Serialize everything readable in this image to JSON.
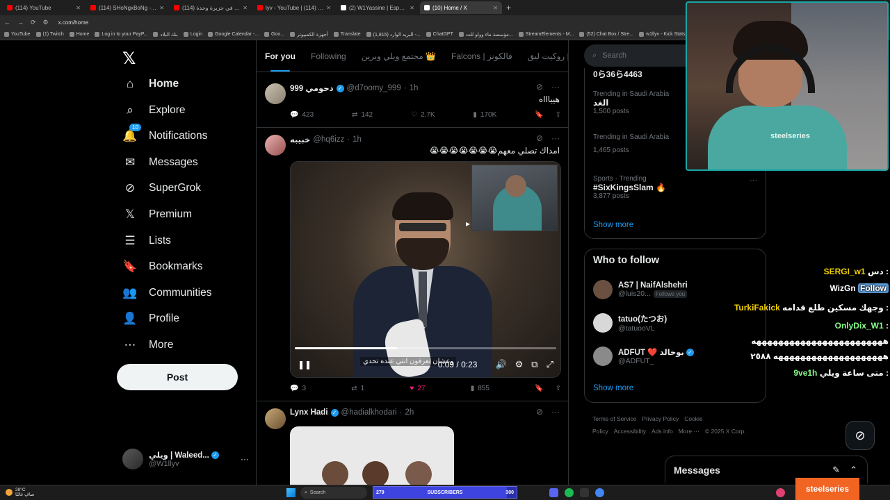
{
  "browser": {
    "tabs": [
      {
        "label": "(114) YouTube",
        "color": "#ff0000"
      },
      {
        "label": "(114) SHoNgxBoNg - YouTube",
        "color": "#ff0000"
      },
      {
        "label": "(114) كل الأغنية في جزيرة وحدة",
        "color": "#ff0000"
      },
      {
        "label": "lyv - YouTube | أبو شمالي (114)",
        "color": "#ff0000"
      },
      {
        "label": "(2) W1Yassine | Esports on X",
        "color": "#ffffff"
      },
      {
        "label": "(10) Home / X",
        "color": "#ffffff",
        "active": true
      }
    ],
    "url": "x.com/home",
    "bookmarks": [
      "YouTube",
      "(1) Twitch",
      "Home",
      "Log in to your PayP...",
      "بنك البلاد",
      "Login",
      "Google Calendar -...",
      "Goo...",
      "أجهزة الكمبيوتر",
      "Translate",
      "(1,815) البريد الوارد -...",
      "ChatGPT",
      "مؤسسة ماء وولو للت...",
      "StreamElements - M...",
      "(52) Chat Box / Stre...",
      "w1llyv - Kick Stats,...",
      "Kick",
      "botr"
    ]
  },
  "nav": {
    "items": [
      {
        "label": "Home",
        "icon": "home-icon",
        "glyph": "⌂",
        "bold": true
      },
      {
        "label": "Explore",
        "icon": "search-icon",
        "glyph": "⌕"
      },
      {
        "label": "Notifications",
        "icon": "bell-icon",
        "glyph": "🔔",
        "badge": "10"
      },
      {
        "label": "Messages",
        "icon": "mail-icon",
        "glyph": "✉"
      },
      {
        "label": "SuperGrok",
        "icon": "grok-icon",
        "glyph": "⊘"
      },
      {
        "label": "Premium",
        "icon": "x-premium-icon",
        "glyph": "𝕏"
      },
      {
        "label": "Lists",
        "icon": "list-icon",
        "glyph": "☰"
      },
      {
        "label": "Bookmarks",
        "icon": "bookmark-icon",
        "glyph": "🔖"
      },
      {
        "label": "Communities",
        "icon": "people-icon",
        "glyph": "👥"
      },
      {
        "label": "Profile",
        "icon": "person-icon",
        "glyph": "👤"
      },
      {
        "label": "More",
        "icon": "more-circle-icon",
        "glyph": "⋯"
      }
    ],
    "post_label": "Post",
    "account": {
      "name": "ويلي | Waleed...",
      "handle": "@W1llyv"
    }
  },
  "timeline": {
    "tabs": [
      {
        "label": "For you",
        "active": true
      },
      {
        "label": "Following"
      },
      {
        "label": "مجتمع ويلي وبرين 👑"
      },
      {
        "label": "Falcons | فالكونز"
      },
      {
        "label": "روكيت ليق | RL"
      }
    ],
    "tweets": [
      {
        "name": "999 دحومي",
        "handle": "@d7oomy_999",
        "time": "1h",
        "text": "هيياااه",
        "replies": "423",
        "reposts": "142",
        "likes": "2.7K",
        "views": "170K"
      },
      {
        "name": "خبيبه",
        "handle": "@hq6izz",
        "time": "1h",
        "text": "امداك تصلي معهم😭😭😭😭😭😭😭",
        "video": {
          "current": "0:09",
          "duration": "0:23",
          "progress": 0.39,
          "subtitle": "وعشان تعرفون انتي عنده تحدي"
        },
        "replies": "3",
        "reposts": "1",
        "likes": "27",
        "views": "855",
        "liked": true
      },
      {
        "name": "Lynx Hadi",
        "handle": "@hadialkhodari",
        "time": "2h"
      }
    ]
  },
  "right": {
    "search_placeholder": "Search",
    "trends": [
      {
        "context": "",
        "title": "0ら36ら4463",
        "count": ""
      },
      {
        "context": "Trending in Saudi Arabia",
        "title": "الغد",
        "count": "1,500 posts"
      },
      {
        "context": "Trending in Saudi Arabia",
        "title": "",
        "count": "1,465 posts"
      },
      {
        "context": "Sports · Trending",
        "title": "#SixKingsSlam 🔥",
        "count": "3,877 posts"
      }
    ],
    "trends_show_more": "Show more",
    "who_to_follow": {
      "title": "Who to follow",
      "users": [
        {
          "name": "AS7 | NaifAlshehri",
          "handle": "@luis20...",
          "follows_you": "Follows you"
        },
        {
          "name": "tatuo(たつお)",
          "handle": "@tatuooVL"
        },
        {
          "name": "ADFUT ❤️ بوخالد",
          "handle": "@ADFUT_"
        }
      ],
      "show_more": "Show more"
    },
    "footer": [
      "Terms of Service",
      "Privacy Policy",
      "Cookie Policy",
      "Accessibility",
      "Ads info",
      "More ···",
      "© 2025 X Corp."
    ]
  },
  "messages_drawer": {
    "title": "Messages"
  },
  "stream_chat": [
    {
      "user": "SERGI_w1",
      "text": ": دس",
      "color": "yellow"
    },
    {
      "user": "Follow",
      "text": "WizGn",
      "color": "blue"
    },
    {
      "user": "TurkiFakick",
      "text": ": وجهك مسكين طلع قدامه",
      "color": "yellow"
    },
    {
      "user": "OnlyDix_W1",
      "text": ":",
      "color": "green"
    },
    {
      "user": "",
      "text": "ههههههههههههههههههههههههه",
      "color": ""
    },
    {
      "user": "",
      "text": "ههههههههههههههههههههه ٢٥٨٨",
      "color": ""
    },
    {
      "user": "9ve1h",
      "text": ": متى ساعة ويلي",
      "color": "green"
    }
  ],
  "webcam": {
    "brand": "steelseries"
  },
  "taskbar": {
    "weather_temp": "28°C",
    "weather_desc": "صافٍ غالبًا",
    "search_label": "Search",
    "subs_current": "279",
    "subs_label": "SUBSCRIBERS",
    "subs_goal": "300",
    "subs_fraction": 0.93,
    "sponsor": "steelseries"
  }
}
